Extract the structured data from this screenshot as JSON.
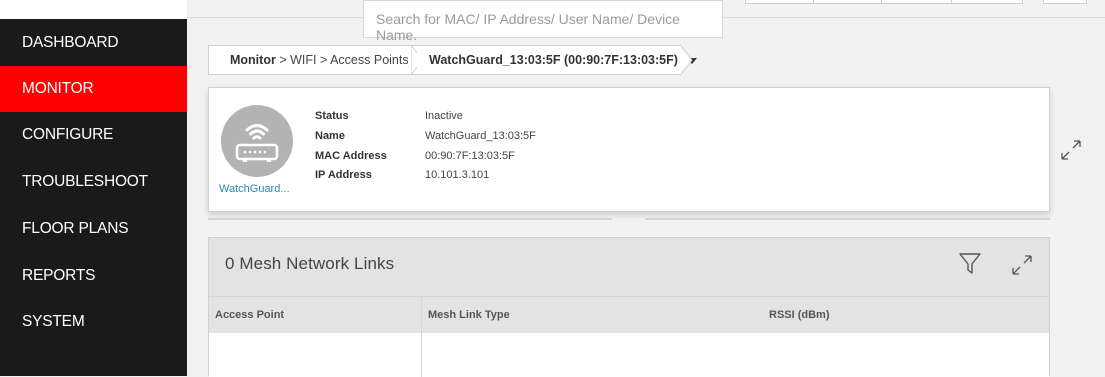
{
  "sidebar": {
    "items": [
      {
        "label": "DASHBOARD",
        "active": false
      },
      {
        "label": "MONITOR",
        "active": true
      },
      {
        "label": "CONFIGURE",
        "active": false
      },
      {
        "label": "TROUBLESHOOT",
        "active": false
      },
      {
        "label": "FLOOR PLANS",
        "active": false
      },
      {
        "label": "REPORTS",
        "active": false
      },
      {
        "label": "SYSTEM",
        "active": false
      }
    ]
  },
  "search": {
    "placeholder": "Search for MAC/ IP Address/ User Name/ Device Name."
  },
  "breadcrumb": {
    "root": "Monitor",
    "separator": ">",
    "level1": "WIFI",
    "level2": "Access Points",
    "current": "WatchGuard_13:03:5F (00:90:7F:13:03:5F)",
    "dropdown_icon": "caret-down-icon"
  },
  "device": {
    "icon": "wifi-access-point-icon",
    "name_short": "WatchGuard...",
    "fields": [
      {
        "key": "Status",
        "value": "Inactive"
      },
      {
        "key": "Name",
        "value": "WatchGuard_13:03:5F"
      },
      {
        "key": "MAC Address",
        "value": "00:90:7F:13:03:5F"
      },
      {
        "key": "IP Address",
        "value": "10.101.3.101"
      }
    ]
  },
  "mesh": {
    "title": "0 Mesh Network Links",
    "columns": [
      "Access Point",
      "Mesh Link Type",
      "RSSI (dBm)"
    ],
    "rows": []
  },
  "colors": {
    "sidebar_bg": "#1a1a1a",
    "active_nav": "#ff0000",
    "link": "#2b8bb0"
  }
}
